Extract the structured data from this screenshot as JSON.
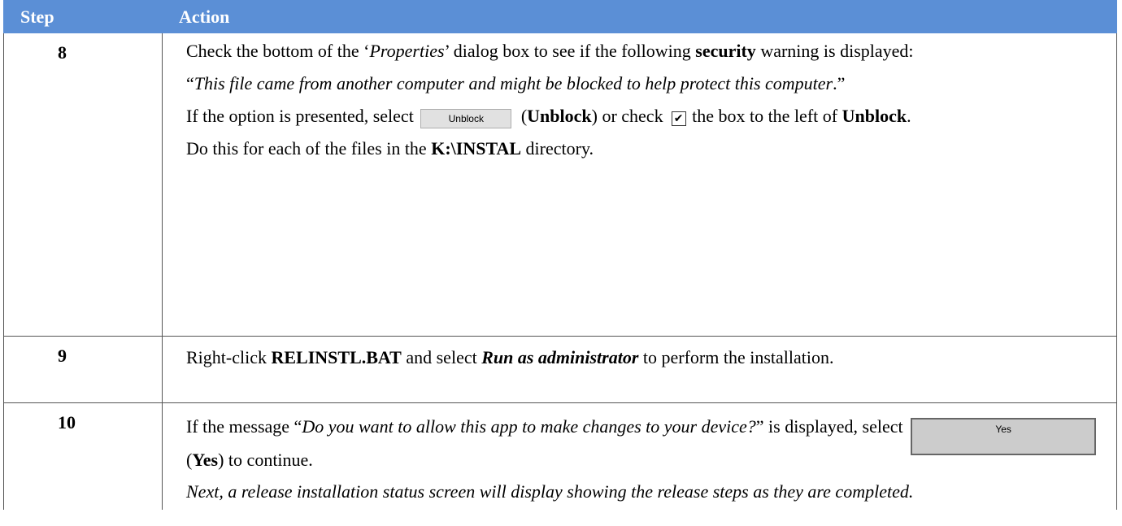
{
  "table": {
    "header": {
      "step": "Step",
      "action": "Action"
    },
    "rows": [
      {
        "step": "8",
        "p1": {
          "a": "Check the bottom of the ‘",
          "b": "Properties",
          "c": "’ dialog box to see if the following ",
          "d": "security",
          "e": " warning is displayed:"
        },
        "p2": {
          "a": "“",
          "b": "This file came from another computer and might be blocked to help protect this computer",
          "c": ".”"
        },
        "p3": {
          "a": "If the option is presented, select",
          "button": "Unblock",
          "b": "(",
          "c": "Unblock",
          "d": ") or check",
          "e": "the box to the left of ",
          "f": "Unblock",
          "g": "."
        },
        "p4": {
          "a": "Do this for each of the files in the ",
          "b": "K:\\INSTAL",
          "c": " directory."
        }
      },
      {
        "step": "9",
        "p1": {
          "a": "Right-click ",
          "b": "RELINSTL.BAT",
          "c": " and select ",
          "d": "Run as administrator",
          "e": " to perform the installation."
        }
      },
      {
        "step": "10",
        "p1": {
          "a": "If the message “",
          "b": "Do you want to allow this app to make changes to your device?",
          "c": "” is displayed, select",
          "button": "Yes",
          "d": "(",
          "e": "Yes",
          "f": ") to continue."
        },
        "p2": "Next, a release installation status screen will display showing the release steps as they are completed."
      }
    ]
  },
  "colors": {
    "header_bg": "#5b8fd6",
    "header_text": "#ffffff",
    "border": "#555555"
  },
  "icons": {
    "checkbox": "checked-checkbox-icon"
  }
}
